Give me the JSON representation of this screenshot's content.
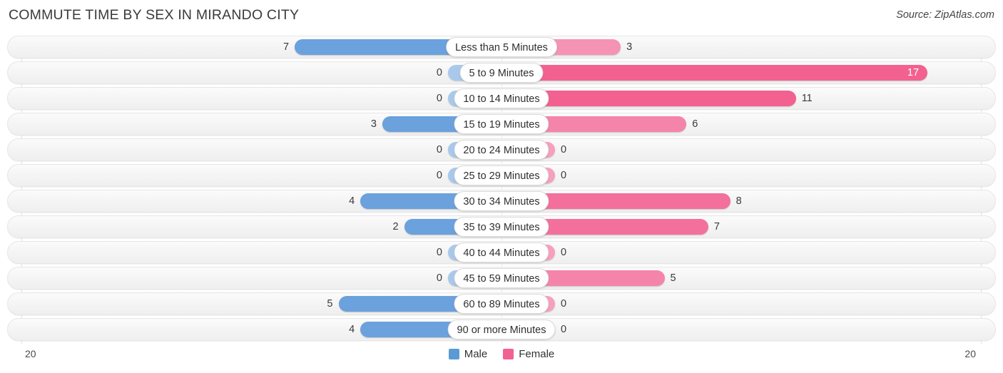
{
  "header": {
    "title": "COMMUTE TIME BY SEX IN MIRANDO CITY",
    "source": "Source: ZipAtlas.com"
  },
  "legend": {
    "items": [
      {
        "label": "Male",
        "color": "#5b9bd5"
      },
      {
        "label": "Female",
        "color": "#f2618f"
      }
    ]
  },
  "axis": {
    "left_label": "20",
    "right_label": "20"
  },
  "colors": {
    "male_strong": "#6ba1dd",
    "male_weak": "#a9c9ec",
    "female_strong": "#f2618f",
    "female_mid": "#f4779f",
    "female_weak": "#f79fbe",
    "track_border": "#e6e6e6",
    "grid": "#e2e2e2"
  },
  "chart_data": {
    "type": "bar",
    "orientation": "horizontal-diverging",
    "title": "COMMUTE TIME BY SEX IN MIRANDO CITY",
    "subtitle": "",
    "xlabel": "",
    "ylabel": "",
    "axis_max": 20,
    "xlim": [
      20,
      20
    ],
    "grid": true,
    "legend_position": "bottom-center",
    "categories": [
      "Less than 5 Minutes",
      "5 to 9 Minutes",
      "10 to 14 Minutes",
      "15 to 19 Minutes",
      "20 to 24 Minutes",
      "25 to 29 Minutes",
      "30 to 34 Minutes",
      "35 to 39 Minutes",
      "40 to 44 Minutes",
      "45 to 59 Minutes",
      "60 to 89 Minutes",
      "90 or more Minutes"
    ],
    "series": [
      {
        "name": "Male",
        "side": "left",
        "values": [
          7,
          0,
          0,
          3,
          0,
          0,
          4,
          2,
          0,
          0,
          5,
          4
        ],
        "labels": [
          "7",
          "0",
          "0",
          "3",
          "0",
          "0",
          "4",
          "2",
          "0",
          "0",
          "5",
          "4"
        ]
      },
      {
        "name": "Female",
        "side": "right",
        "values": [
          3,
          17,
          11,
          6,
          0,
          0,
          8,
          7,
          0,
          5,
          0,
          0
        ],
        "labels": [
          "3",
          "17",
          "11",
          "6",
          "0",
          "0",
          "8",
          "7",
          "0",
          "5",
          "0",
          "0"
        ]
      }
    ],
    "rows": [
      {
        "category": "Less than 5 Minutes",
        "male": 7,
        "female": 3,
        "male_label": "7",
        "female_label": "3"
      },
      {
        "category": "5 to 9 Minutes",
        "male": 0,
        "female": 17,
        "male_label": "0",
        "female_label": "17"
      },
      {
        "category": "10 to 14 Minutes",
        "male": 0,
        "female": 11,
        "male_label": "0",
        "female_label": "11"
      },
      {
        "category": "15 to 19 Minutes",
        "male": 3,
        "female": 6,
        "male_label": "3",
        "female_label": "6"
      },
      {
        "category": "20 to 24 Minutes",
        "male": 0,
        "female": 0,
        "male_label": "0",
        "female_label": "0"
      },
      {
        "category": "25 to 29 Minutes",
        "male": 0,
        "female": 0,
        "male_label": "0",
        "female_label": "0"
      },
      {
        "category": "30 to 34 Minutes",
        "male": 4,
        "female": 8,
        "male_label": "4",
        "female_label": "8"
      },
      {
        "category": "35 to 39 Minutes",
        "male": 2,
        "female": 7,
        "male_label": "2",
        "female_label": "7"
      },
      {
        "category": "40 to 44 Minutes",
        "male": 0,
        "female": 0,
        "male_label": "0",
        "female_label": "0"
      },
      {
        "category": "45 to 59 Minutes",
        "male": 0,
        "female": 5,
        "male_label": "0",
        "female_label": "5"
      },
      {
        "category": "60 to 89 Minutes",
        "male": 5,
        "female": 0,
        "male_label": "5",
        "female_label": "0"
      },
      {
        "category": "90 or more Minutes",
        "male": 4,
        "female": 0,
        "male_label": "4",
        "female_label": "0"
      }
    ]
  }
}
